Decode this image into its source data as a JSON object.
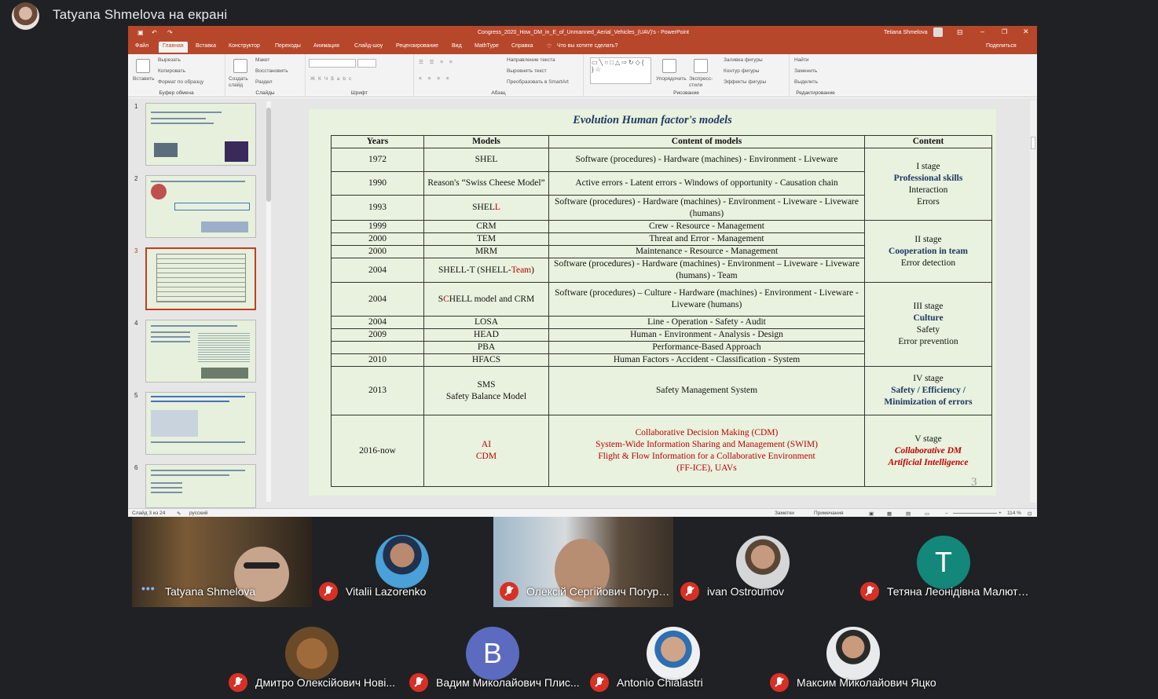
{
  "meet": {
    "presenting_title": "Tatyana Shmelova на екрані"
  },
  "powerpoint": {
    "window_title": "Congress_2020_How_DM_in_E_of_Unmanned_Aerial_Vehicles_(UAV)'s - PowerPoint",
    "user": "Tetiana Shmelova",
    "tabs": [
      "Файл",
      "Главная",
      "Вставка",
      "Конструктор",
      "Переходы",
      "Анимация",
      "Слайд-шоу",
      "Рецензирование",
      "Вид",
      "MathType",
      "Справка"
    ],
    "active_tab": "Главная",
    "tell_me": "Что вы хотите сделать?",
    "share": "Поделиться",
    "ribbon": {
      "paste": "Вставить",
      "cut": "Вырезать",
      "copy": "Копировать",
      "format_painter": "Формат по образцу",
      "clipboard": "Буфер обмена",
      "new_slide": "Создать слайд",
      "layout": "Макет",
      "reset": "Восстановить",
      "section": "Раздел",
      "slides": "Слайды",
      "font": "Шрифт",
      "text_direction": "Направление текста",
      "align_text": "Выровнять текст",
      "smartart": "Преобразовать в SmartArt",
      "paragraph": "Абзац",
      "arrange": "Упорядочить",
      "quick_styles": "Экспресс-стили",
      "shape_fill": "Заливка фигуры",
      "shape_outline": "Контур фигуры",
      "shape_effects": "Эффекты фигуры",
      "drawing": "Рисование",
      "find": "Найти",
      "replace": "Заменить",
      "select": "Выделить",
      "editing": "Редактирование"
    },
    "thumbnails": [
      "1",
      "2",
      "3",
      "4",
      "5",
      "6"
    ],
    "status": {
      "slide": "Слайд 3 из 24",
      "language": "русский",
      "notes": "Заметки",
      "comments": "Примечания",
      "zoom": "114 %"
    }
  },
  "slide": {
    "title": "Evolution Human factor's models",
    "page_number": "3",
    "headers": [
      "Years",
      "Models",
      "Content of models",
      "Content"
    ],
    "rows": [
      {
        "year": "1972",
        "model": "SHEL",
        "content": "Software (procedures) - Hardware (machines) - Environment - Liveware"
      },
      {
        "year": "1990",
        "model": "Reason's “Swiss Cheese Model”",
        "content": "Active errors - Latent errors - Windows of opportunity - Causation chain"
      },
      {
        "year": "1993",
        "model_a": "SHEL",
        "model_b": "L",
        "content": "Software (procedures) - Hardware (machines) - Environment - Liveware - Liveware (humans)"
      },
      {
        "year": "1999",
        "model": "CRM",
        "content": "Crew - Resource - Management"
      },
      {
        "year": "2000",
        "model": "TEM",
        "content": "Threat and Error - Management"
      },
      {
        "year": "2000",
        "model": "MRM",
        "content": "Maintenance - Resource - Management"
      },
      {
        "year": "2004",
        "model_a": "SHELL-T (SHELL-",
        "model_b": "Team",
        "model_c": ")",
        "content": "Software (procedures) - Hardware (machines) - Environment – Liveware - Liveware (humans) - Team"
      },
      {
        "year": "2004",
        "model_a": "S",
        "model_b": "C",
        "model_c": "HELL model and CRM",
        "content": "Software (procedures) – Culture - Hardware (machines) - Environment - Liveware - Liveware (humans)"
      },
      {
        "year": "2004",
        "model": "LOSA",
        "content": "Line - Operation - Safety - Audit"
      },
      {
        "year": "2009",
        "model": "HEAD",
        "content": "Human - Environment - Analysis - Design"
      },
      {
        "year": "",
        "model": "PBA",
        "content": "Performance-Based Approach"
      },
      {
        "year": "2010",
        "model": "HFACS",
        "content": "Human Factors - Accident - Classification - System"
      },
      {
        "year": "2013",
        "model": "SMS",
        "model_2": "Safety Balance Model",
        "content": "Safety Management System"
      },
      {
        "year": "2016-now",
        "model": "AI",
        "model_2": "CDM",
        "content_lines": [
          "Collaborative Decision Making (CDM)",
          "System-Wide Information Sharing and Management (SWIM)",
          "Flight & Flow Information for a Collaborative Environment",
          "(FF-ICE), UAVs"
        ]
      }
    ],
    "stages": [
      {
        "stage": "I stage",
        "bold": "Professional skills",
        "lines": [
          "Interaction",
          "Errors"
        ]
      },
      {
        "stage": "II stage",
        "bold": "Cooperation  in team",
        "lines": [
          "Error detection"
        ]
      },
      {
        "stage": "III stage",
        "bold": "Culture",
        "lines": [
          "Safety",
          "Error prevention"
        ]
      },
      {
        "stage": "IV stage",
        "bold": "Safety / Efficiency /",
        "bold2": "Minimization of errors"
      },
      {
        "stage": "V stage",
        "red": "Collaborative DM",
        "red2": "Artificial Intelligence"
      }
    ]
  },
  "participants": [
    {
      "name": "Tatyana Shmelova",
      "muted": false
    },
    {
      "name": "Vitalii Lazorenko",
      "muted": true
    },
    {
      "name": "Олексій Сергійович Погуре...",
      "muted": true
    },
    {
      "name": "ivan Ostroumov",
      "muted": true
    },
    {
      "name": "Тетяна Леонідівна Малюте...",
      "muted": true,
      "letter": "T",
      "color": "#12877a"
    },
    {
      "name": "Дмитро Олексійович Нові...",
      "muted": true
    },
    {
      "name": "Вадим Миколайович Плис...",
      "muted": true,
      "letter": "В",
      "color": "#5c6bc0"
    },
    {
      "name": "Antonio Chialastri",
      "muted": true
    },
    {
      "name": "Максим Миколайович Яцко",
      "muted": true
    }
  ]
}
